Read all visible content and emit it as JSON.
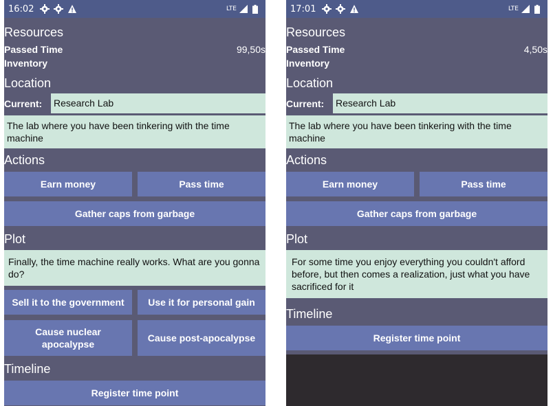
{
  "left": {
    "status": {
      "time": "16:02",
      "network": "LTE"
    },
    "resources": {
      "title": "Resources",
      "passed_label": "Passed Time",
      "passed_value": "99,50s",
      "inventory_label": "Inventory"
    },
    "location": {
      "title": "Location",
      "current_label": "Current:",
      "current_value": "Research Lab",
      "description": "The lab where you have been tinkering with the time machine"
    },
    "actions": {
      "title": "Actions",
      "earn": "Earn money",
      "pass": "Pass time",
      "gather": "Gather caps from garbage"
    },
    "plot": {
      "title": "Plot",
      "text": "Finally, the time machine really works. What are you gonna do?",
      "options": [
        "Sell it to the government",
        "Use it for personal gain",
        "Cause nuclear apocalypse",
        "Cause post-apocalypse"
      ]
    },
    "timeline": {
      "title": "Timeline",
      "register": "Register time point"
    }
  },
  "right": {
    "status": {
      "time": "17:01",
      "network": "LTE"
    },
    "resources": {
      "title": "Resources",
      "passed_label": "Passed Time",
      "passed_value": "4,50s",
      "inventory_label": "Inventory"
    },
    "location": {
      "title": "Location",
      "current_label": "Current:",
      "current_value": "Research Lab",
      "description": "The lab where you have been tinkering with the time machine"
    },
    "actions": {
      "title": "Actions",
      "earn": "Earn money",
      "pass": "Pass time",
      "gather": "Gather caps from garbage"
    },
    "plot": {
      "title": "Plot",
      "text": "For some time you enjoy everything you couldn't afford before, but then comes a realization, just what you have sacrificed for it"
    },
    "timeline": {
      "title": "Timeline",
      "register": "Register time point"
    }
  },
  "colors": {
    "background": "#5a5a74",
    "statusbar": "#4e5b8a",
    "button": "#6876b0",
    "textbox": "#cfe7dc",
    "dark_area": "#2e2a2e"
  },
  "status_icons": [
    "gear-icon",
    "gear-icon",
    "warning-icon",
    "lte-signal-icon",
    "battery-icon"
  ]
}
